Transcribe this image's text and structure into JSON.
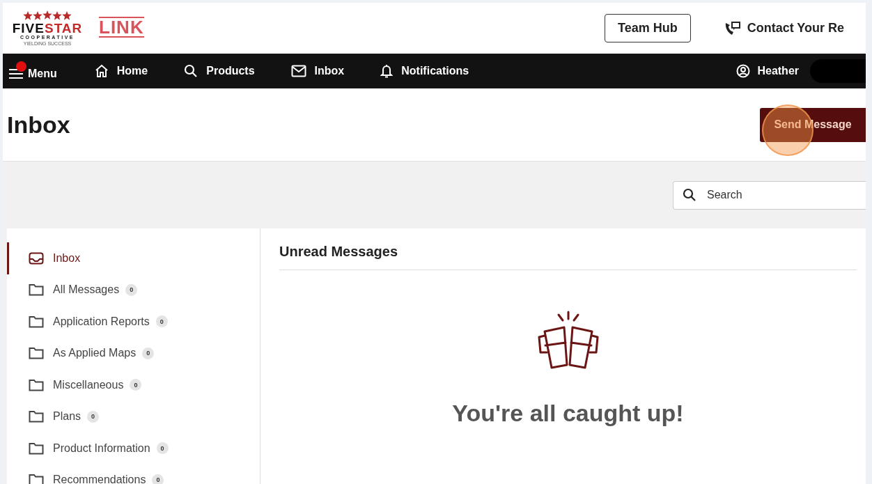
{
  "header": {
    "logo": {
      "brand_start": "FIVE",
      "brand_end": "STAR",
      "subtitle": "COOPERATIVE",
      "tagline": "YIELDING SUCCESS",
      "product": "LINK"
    },
    "team_hub_button": "Team Hub",
    "contact_link": "Contact Your Re"
  },
  "nav": {
    "menu": {
      "label": "Menu",
      "notification_dot": true
    },
    "items": [
      {
        "label": "Home",
        "kind": "home"
      },
      {
        "label": "Products",
        "kind": "search"
      },
      {
        "label": "Inbox",
        "kind": "mail"
      },
      {
        "label": "Notifications",
        "kind": "bell"
      }
    ],
    "user": {
      "name": "Heather"
    }
  },
  "page": {
    "title": "Inbox",
    "send_button": "Send Message"
  },
  "search": {
    "placeholder": "Search"
  },
  "sidebar": {
    "items": [
      {
        "label": "Inbox",
        "kind": "inbox",
        "selected": true
      },
      {
        "label": "All Messages",
        "kind": "folder",
        "count": "0",
        "selected": false
      },
      {
        "label": "Application Reports",
        "kind": "folder",
        "count": "0",
        "selected": false
      },
      {
        "label": "As Applied Maps",
        "kind": "folder",
        "count": "0",
        "selected": false
      },
      {
        "label": "Miscellaneous",
        "kind": "folder",
        "count": "0",
        "selected": false
      },
      {
        "label": "Plans",
        "kind": "folder",
        "count": "0",
        "selected": false
      },
      {
        "label": "Product Information",
        "kind": "folder",
        "count": "0",
        "selected": false
      },
      {
        "label": "Recommendations",
        "kind": "folder",
        "count": "0",
        "selected": false
      }
    ]
  },
  "messages": {
    "heading": "Unread Messages",
    "empty_text": "You're all caught up!"
  }
}
